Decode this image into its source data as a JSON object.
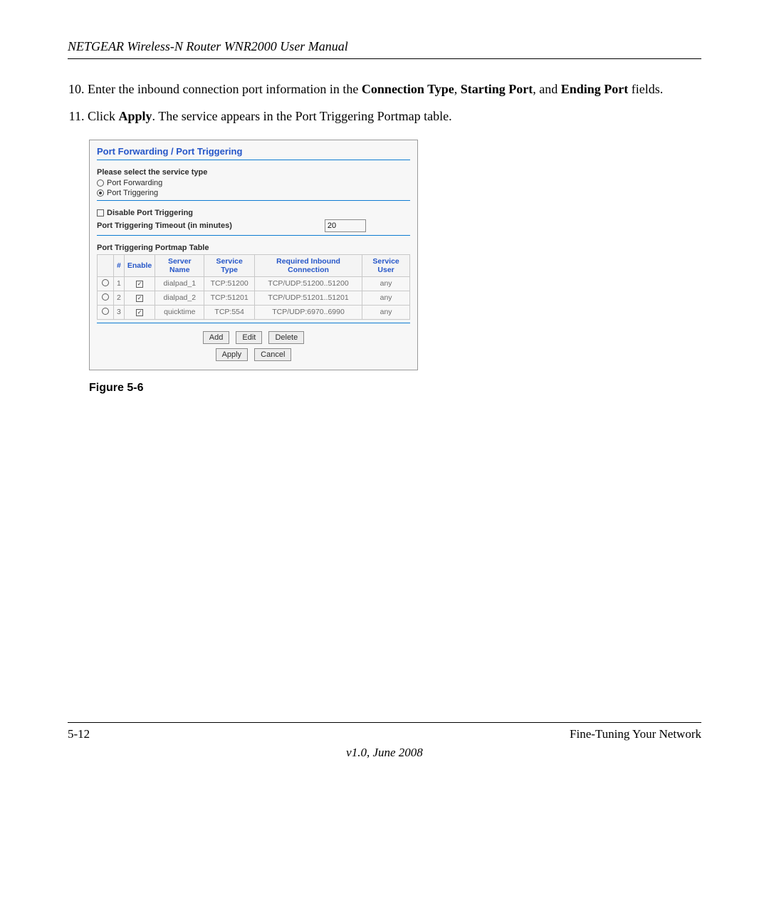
{
  "header": {
    "title": "NETGEAR Wireless-N Router WNR2000 User Manual"
  },
  "steps": {
    "step10_num": "10.",
    "step10_prefix": "Enter the inbound connection port information in the ",
    "step10_b1": "Connection Type",
    "step10_sep1": ", ",
    "step10_b2": "Starting Port",
    "step10_sep2": ", and ",
    "step10_b3": "Ending Port",
    "step10_suffix": " fields.",
    "step11_num": "11.",
    "step11_prefix": "Click ",
    "step11_b1": "Apply",
    "step11_suffix": ". The service appears in the Port Triggering Portmap table."
  },
  "ui": {
    "panel_title": "Port Forwarding / Port Triggering",
    "service_type_label": "Please select the service type",
    "radio_forwarding": "Port Forwarding",
    "radio_triggering": "Port Triggering",
    "disable_label": "Disable Port Triggering",
    "timeout_label": "Port Triggering Timeout (in minutes)",
    "timeout_value": "20",
    "table_title": "Port Triggering Portmap Table",
    "headers": [
      "#",
      "Enable",
      "Server Name",
      "Service Type",
      "Required Inbound Connection",
      "Service User"
    ],
    "rows": [
      {
        "num": "1",
        "enabled": true,
        "name": "dialpad_1",
        "stype": "TCP:51200",
        "inbound": "TCP/UDP:51200..51200",
        "user": "any"
      },
      {
        "num": "2",
        "enabled": true,
        "name": "dialpad_2",
        "stype": "TCP:51201",
        "inbound": "TCP/UDP:51201..51201",
        "user": "any"
      },
      {
        "num": "3",
        "enabled": true,
        "name": "quicktime",
        "stype": "TCP:554",
        "inbound": "TCP/UDP:6970..6990",
        "user": "any"
      }
    ],
    "buttons": {
      "add": "Add",
      "edit": "Edit",
      "delete": "Delete",
      "apply": "Apply",
      "cancel": "Cancel"
    }
  },
  "figure_label": "Figure 5-6",
  "footer": {
    "page": "5-12",
    "section": "Fine-Tuning Your Network",
    "version": "v1.0, June 2008"
  }
}
